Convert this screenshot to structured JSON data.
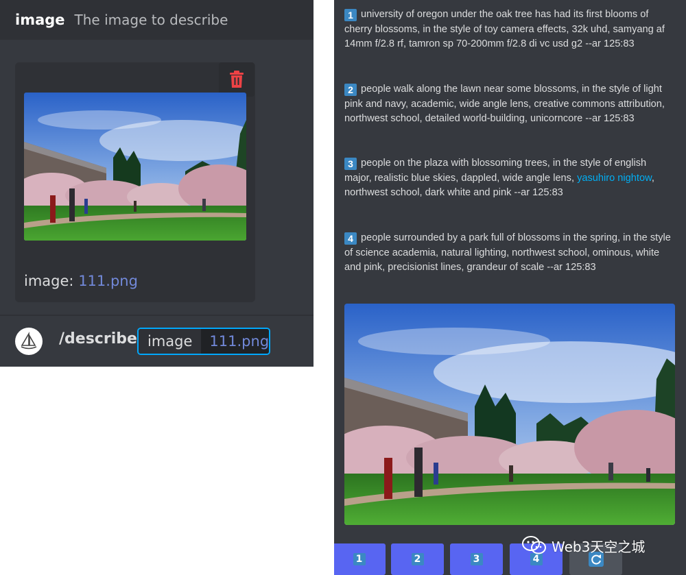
{
  "option_header": {
    "name": "image",
    "description": "The image to describe"
  },
  "attachment": {
    "caption_key": "image:",
    "filename": "111.png",
    "delete_icon": "trash-icon"
  },
  "command": {
    "name": "/describe",
    "param_key": "image",
    "param_value": "111.png"
  },
  "descriptions": [
    {
      "number": "1",
      "text": "university of oregon under the oak tree has had its first blooms of cherry blossoms, in the style of toy camera effects, 32k uhd, samyang af 14mm f/2.8 rf, tamron sp 70-200mm f/2.8 di vc usd g2 --ar 125:83"
    },
    {
      "number": "2",
      "text": "people walk along the lawn near some blossoms, in the style of light pink and navy, academic, wide angle lens, creative commons attribution, northwest school, detailed world-building, unicorncore --ar 125:83"
    },
    {
      "number": "3",
      "text_before": "people on the plaza with blossoming trees, in the style of english major, realistic blue skies, dappled, wide angle lens,",
      "link": "yasuhiro nightow",
      "text_after": ", northwest school, dark white and pink --ar 125:83"
    },
    {
      "number": "4",
      "text": "people surrounded by a park full of blossoms in the spring, in the style of science academia, natural lighting, northwest school, ominous, white and pink, precisionist lines, grandeur of scale --ar 125:83"
    }
  ],
  "buttons": [
    "1",
    "2",
    "3",
    "4"
  ],
  "reroll_icon": "refresh-icon",
  "watermark": "Web3天空之城",
  "colors": {
    "blurple": "#5865f2",
    "link": "#00aff4",
    "delete": "#ed4245",
    "number_badge": "#3b88c3"
  }
}
